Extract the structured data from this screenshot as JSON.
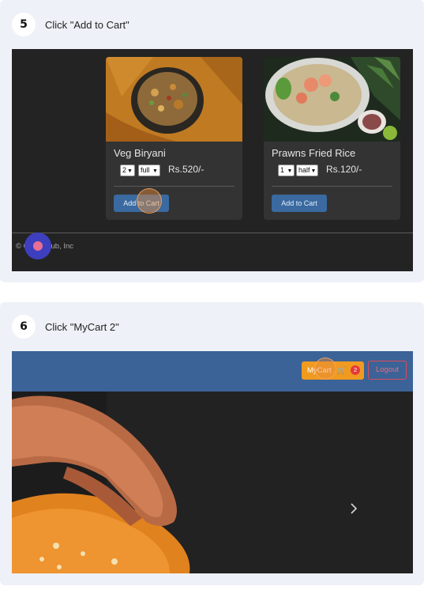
{
  "steps": [
    {
      "number": "5",
      "instruction": "Click \"Add to Cart\""
    },
    {
      "number": "6",
      "instruction": "Click \"MyCart 2\""
    }
  ],
  "screen5": {
    "products": [
      {
        "name": "Veg Biryani",
        "quantity": "2",
        "size": "full",
        "price": "Rs.520/-",
        "button": "Add to Cart",
        "image_icon": "biryani-photo"
      },
      {
        "name": "Prawns Fried Rice",
        "quantity": "1",
        "size": "half",
        "price": "Rs.120/-",
        "button": "Add to Cart",
        "image_icon": "fried-rice-photo"
      }
    ],
    "footer": "© GoodyHub, Inc"
  },
  "screen6": {
    "nav": {
      "cart_label": "MyCart",
      "cart_icon": "cart-icon",
      "cart_count": "2",
      "logout_label": "Logout"
    },
    "carousel": {
      "next_icon": "chevron-right-icon"
    }
  },
  "colors": {
    "card_bg": "#eef1f7",
    "app_dark": "#232323",
    "product_card": "#333333",
    "primary_button": "#3a6aa0",
    "navbar": "#3b6397",
    "cart_button": "#f09a20",
    "badge": "#e33a3a",
    "logout": "#e04a5a",
    "click_marker": "#3d3fbf"
  }
}
